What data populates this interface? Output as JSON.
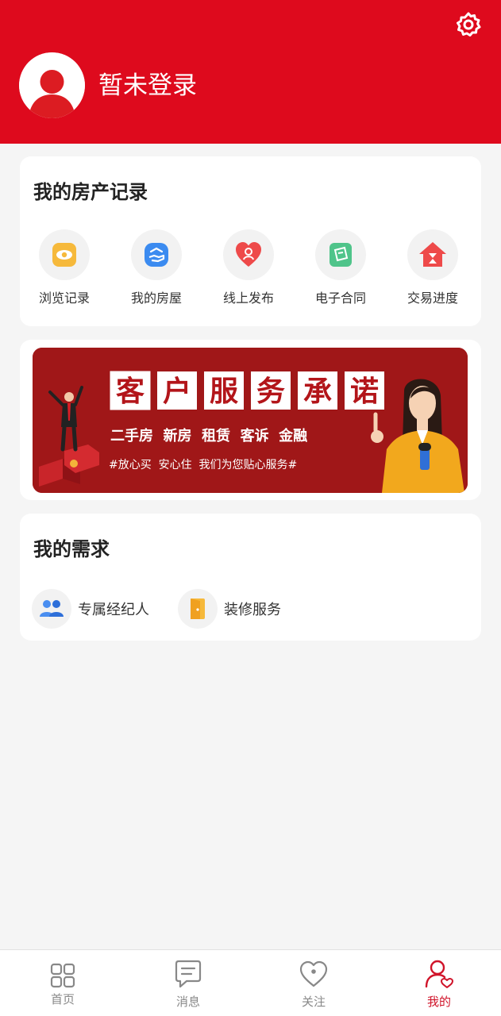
{
  "header": {
    "login_text": "暂未登录",
    "bg_color": "#de0a1d",
    "settings_icon": "gear-icon",
    "avatar_icon": "user-avatar-icon"
  },
  "records": {
    "title": "我的房产记录",
    "items": [
      {
        "label": "浏览记录",
        "icon": "eye-icon"
      },
      {
        "label": "我的房屋",
        "icon": "house-hand-icon"
      },
      {
        "label": "线上发布",
        "icon": "heart-publish-icon"
      },
      {
        "label": "电子合同",
        "icon": "contract-icon"
      },
      {
        "label": "交易进度",
        "icon": "hourglass-house-icon"
      }
    ]
  },
  "banner": {
    "title_chars": [
      "客",
      "户",
      "服",
      "务",
      "承",
      "诺"
    ],
    "services": "二手房  新房  租赁  客诉  金融",
    "slogan": "#放心买  安心住  我们为您贴心服务#"
  },
  "needs": {
    "title": "我的需求",
    "items": [
      {
        "label": "专属经纪人",
        "icon": "agents-icon"
      },
      {
        "label": "装修服务",
        "icon": "door-icon"
      }
    ]
  },
  "nav": {
    "items": [
      {
        "label": "首页",
        "icon": "grid-icon"
      },
      {
        "label": "消息",
        "icon": "message-icon"
      },
      {
        "label": "关注",
        "icon": "heart-icon"
      },
      {
        "label": "我的",
        "icon": "user-icon"
      }
    ],
    "active": "我的",
    "active_color": "#d0142a"
  }
}
